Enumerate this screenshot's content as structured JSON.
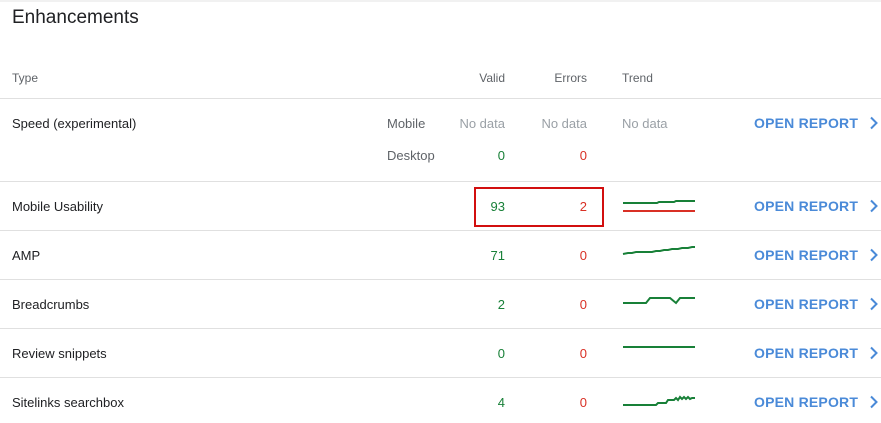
{
  "title": "Enhancements",
  "columns": {
    "type": "Type",
    "valid": "Valid",
    "errors": "Errors",
    "trend": "Trend"
  },
  "open_label": "OPEN REPORT",
  "speed": {
    "label": "Speed (experimental)",
    "mobile_label": "Mobile",
    "desktop_label": "Desktop",
    "mobile_valid": "No data",
    "mobile_errors": "No data",
    "mobile_trend": "No data",
    "desktop_valid": "0",
    "desktop_errors": "0"
  },
  "rows": [
    {
      "label": "Mobile Usability",
      "valid": "93",
      "errors": "2"
    },
    {
      "label": "AMP",
      "valid": "71",
      "errors": "0"
    },
    {
      "label": "Breadcrumbs",
      "valid": "2",
      "errors": "0"
    },
    {
      "label": "Review snippets",
      "valid": "0",
      "errors": "0"
    },
    {
      "label": "Sitelinks searchbox",
      "valid": "4",
      "errors": "0"
    }
  ],
  "colors": {
    "valid": "#188038",
    "errors": "#d93025",
    "link": "#4a8ad8",
    "highlight": "#d20f0f"
  },
  "icons": {
    "open_report": "chevron-right-icon"
  }
}
